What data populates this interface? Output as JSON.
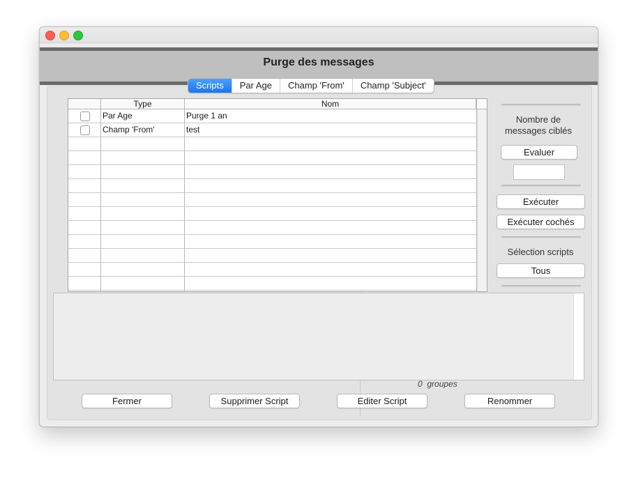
{
  "window": {
    "title": "Purge des messages"
  },
  "tabs": [
    {
      "label": "Scripts",
      "active": true
    },
    {
      "label": "Par Age",
      "active": false
    },
    {
      "label": "Champ 'From'",
      "active": false
    },
    {
      "label": "Champ 'Subject'",
      "active": false
    }
  ],
  "table": {
    "headers": {
      "check": "",
      "type": "Type",
      "name": "Nom"
    },
    "rows": [
      {
        "checked": false,
        "type": "Par Age",
        "name": "Purge 1 an"
      },
      {
        "checked": false,
        "type": "Champ 'From'",
        "name": "test"
      },
      {
        "checked": false,
        "type": "",
        "name": ""
      },
      {
        "checked": false,
        "type": "",
        "name": ""
      },
      {
        "checked": false,
        "type": "",
        "name": ""
      },
      {
        "checked": false,
        "type": "",
        "name": ""
      },
      {
        "checked": false,
        "type": "",
        "name": ""
      },
      {
        "checked": false,
        "type": "",
        "name": ""
      },
      {
        "checked": false,
        "type": "",
        "name": ""
      },
      {
        "checked": false,
        "type": "",
        "name": ""
      },
      {
        "checked": false,
        "type": "",
        "name": ""
      },
      {
        "checked": false,
        "type": "",
        "name": ""
      },
      {
        "checked": false,
        "type": "",
        "name": ""
      }
    ]
  },
  "side": {
    "targeted_label_line1": "Nombre de",
    "targeted_label_line2": "messages ciblés",
    "evaluate_label": "Evaluer",
    "count_value": "",
    "execute_label": "Exécuter",
    "execute_checked_label": "Exécuter cochés",
    "selection_label": "Sélection scripts",
    "all_label": "Tous"
  },
  "log": {
    "groups_count": "0",
    "groups_label": "groupes"
  },
  "footer": {
    "close_label": "Fermer",
    "delete_label": "Supprimer Script",
    "edit_label": "Editer Script",
    "rename_label": "Renommer"
  },
  "colors": {
    "active_tab": "#1c74f0",
    "header_band": "#bfbfbf",
    "header_border": "#6a6a6a"
  }
}
